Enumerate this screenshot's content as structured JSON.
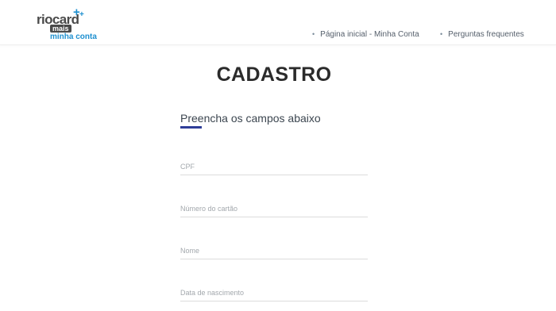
{
  "header": {
    "logo": {
      "brand": "riocard",
      "sub": "mais",
      "tagline": "minha conta",
      "plus_symbol": "+"
    },
    "nav": [
      {
        "label": "Página inicial - Minha Conta"
      },
      {
        "label": "Perguntas frequentes"
      }
    ]
  },
  "main": {
    "title": "CADASTRO",
    "subtitle": "Preencha os campos abaixo",
    "fields": [
      {
        "placeholder": "CPF",
        "value": ""
      },
      {
        "placeholder": "Número do cartão",
        "value": ""
      },
      {
        "placeholder": "Nome",
        "value": ""
      },
      {
        "placeholder": "Data de nascimento",
        "value": ""
      }
    ]
  },
  "colors": {
    "accent": "#2e3d98",
    "brand_blue": "#1e90d0",
    "brand_gray": "#4a4a4a"
  }
}
